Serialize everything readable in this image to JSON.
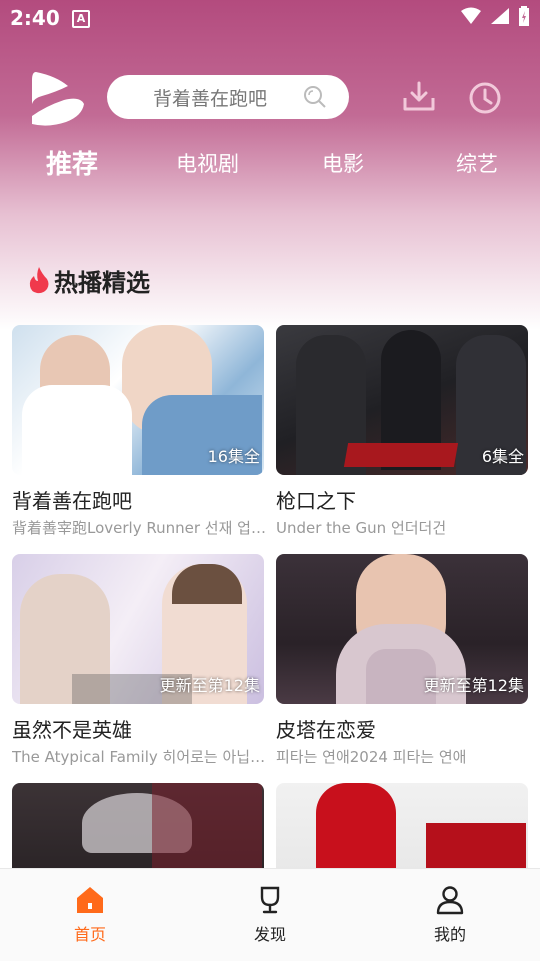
{
  "status": {
    "time": "2:40",
    "notif": "A"
  },
  "header": {
    "search_placeholder": "背着善在跑吧"
  },
  "tabs": [
    {
      "label": "推荐"
    },
    {
      "label": "电视剧"
    },
    {
      "label": "电影"
    },
    {
      "label": "综艺"
    }
  ],
  "section": {
    "title": "热播精选"
  },
  "cards": [
    {
      "title": "背着善在跑吧",
      "subtitle": "背着善宰跑Loverly Runner 선재 업…",
      "badge": "16集全"
    },
    {
      "title": "枪口之下",
      "subtitle": "Under the Gun 언더더건",
      "badge": "6集全"
    },
    {
      "title": "虽然不是英雄",
      "subtitle": "The Atypical Family 히어로는 아닙…",
      "badge": "更新至第12集"
    },
    {
      "title": "皮塔在恋爱",
      "subtitle": "피타는 연애2024 피타는 연애",
      "badge": "更新至第12集"
    }
  ],
  "nav": [
    {
      "label": "首页"
    },
    {
      "label": "发现"
    },
    {
      "label": "我的"
    }
  ],
  "colors": {
    "accent": "#ff6a1a",
    "header_pink": "#b34b7e"
  }
}
